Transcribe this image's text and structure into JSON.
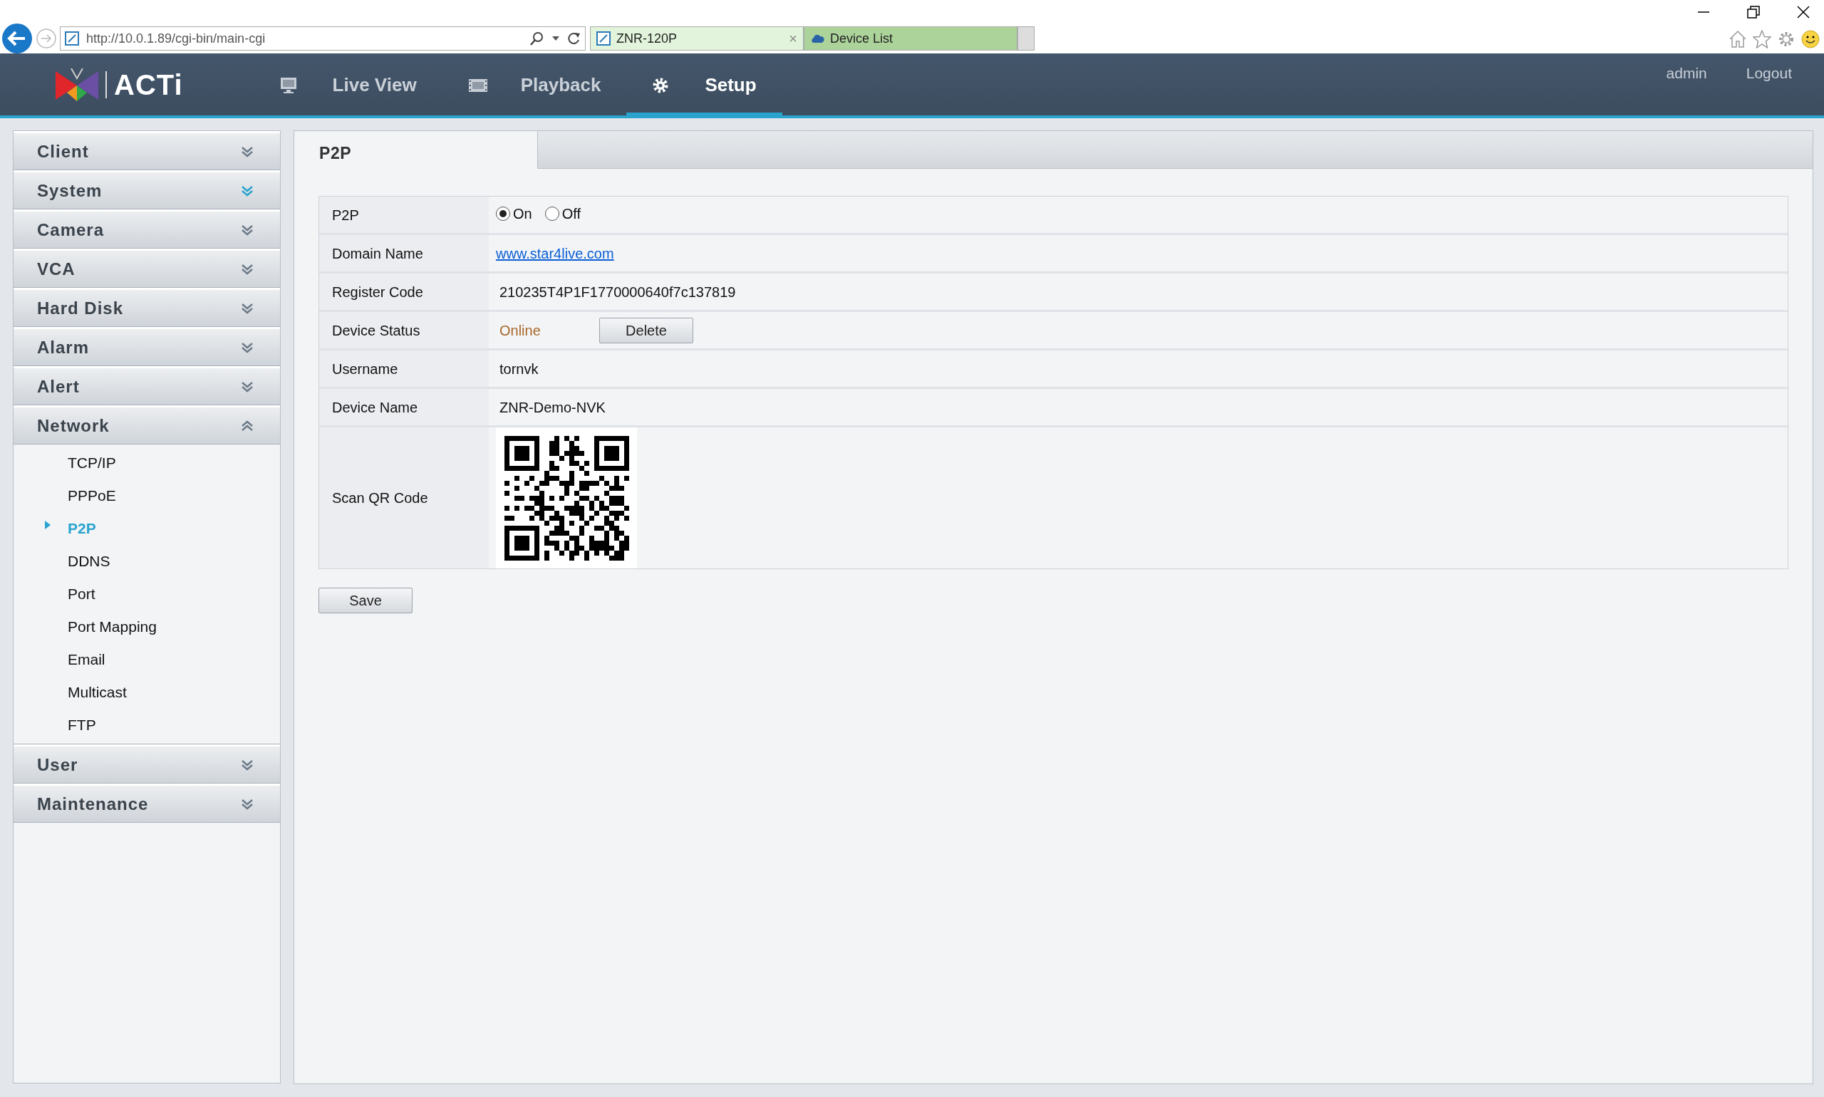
{
  "browser": {
    "address": "http://10.0.1.89/cgi-bin/main-cgi",
    "tabs": [
      {
        "label": "ZNR-120P",
        "selected": true,
        "close": "×"
      },
      {
        "label": "Device List",
        "selected": false
      }
    ]
  },
  "header": {
    "logo": "ACTi",
    "nav": [
      {
        "label": "Live View",
        "kind": "live",
        "selected": false
      },
      {
        "label": "Playback",
        "kind": "playback",
        "selected": false
      },
      {
        "label": "Setup",
        "kind": "setup",
        "selected": true
      }
    ],
    "user": "admin",
    "logout": "Logout"
  },
  "sidebar": [
    {
      "label": "Client",
      "expanded": false,
      "hovered": false
    },
    {
      "label": "System",
      "expanded": false,
      "hovered": true
    },
    {
      "label": "Camera",
      "expanded": false,
      "hovered": false
    },
    {
      "label": "VCA",
      "expanded": false,
      "hovered": false
    },
    {
      "label": "Hard Disk",
      "expanded": false,
      "hovered": false
    },
    {
      "label": "Alarm",
      "expanded": false,
      "hovered": false
    },
    {
      "label": "Alert",
      "expanded": false,
      "hovered": false
    },
    {
      "label": "Network",
      "expanded": true,
      "hovered": false,
      "children": [
        {
          "label": "TCP/IP",
          "selected": false
        },
        {
          "label": "PPPoE",
          "selected": false
        },
        {
          "label": "P2P",
          "selected": true
        },
        {
          "label": "DDNS",
          "selected": false
        },
        {
          "label": "Port",
          "selected": false
        },
        {
          "label": "Port Mapping",
          "selected": false
        },
        {
          "label": "Email",
          "selected": false
        },
        {
          "label": "Multicast",
          "selected": false
        },
        {
          "label": "FTP",
          "selected": false
        }
      ]
    },
    {
      "label": "User",
      "expanded": false,
      "hovered": false
    },
    {
      "label": "Maintenance",
      "expanded": false,
      "hovered": false
    }
  ],
  "panel": {
    "tab": "P2P",
    "rows": [
      {
        "kind": "radio",
        "label": "P2P",
        "options": [
          {
            "label": "On",
            "selected": true
          },
          {
            "label": "Off",
            "selected": false
          }
        ]
      },
      {
        "kind": "link",
        "label": "Domain Name",
        "value": "www.star4live.com"
      },
      {
        "kind": "text",
        "label": "Register Code",
        "value": "210235T4P1F1770000640f7c137819"
      },
      {
        "kind": "status",
        "label": "Device Status",
        "value": "Online",
        "button": "Delete"
      },
      {
        "kind": "text",
        "label": "Username",
        "value": "tornvk"
      },
      {
        "kind": "text",
        "label": "Device Name",
        "value": "ZNR-Demo-NVK"
      },
      {
        "kind": "qr",
        "label": "Scan QR Code"
      }
    ],
    "save": "Save"
  }
}
